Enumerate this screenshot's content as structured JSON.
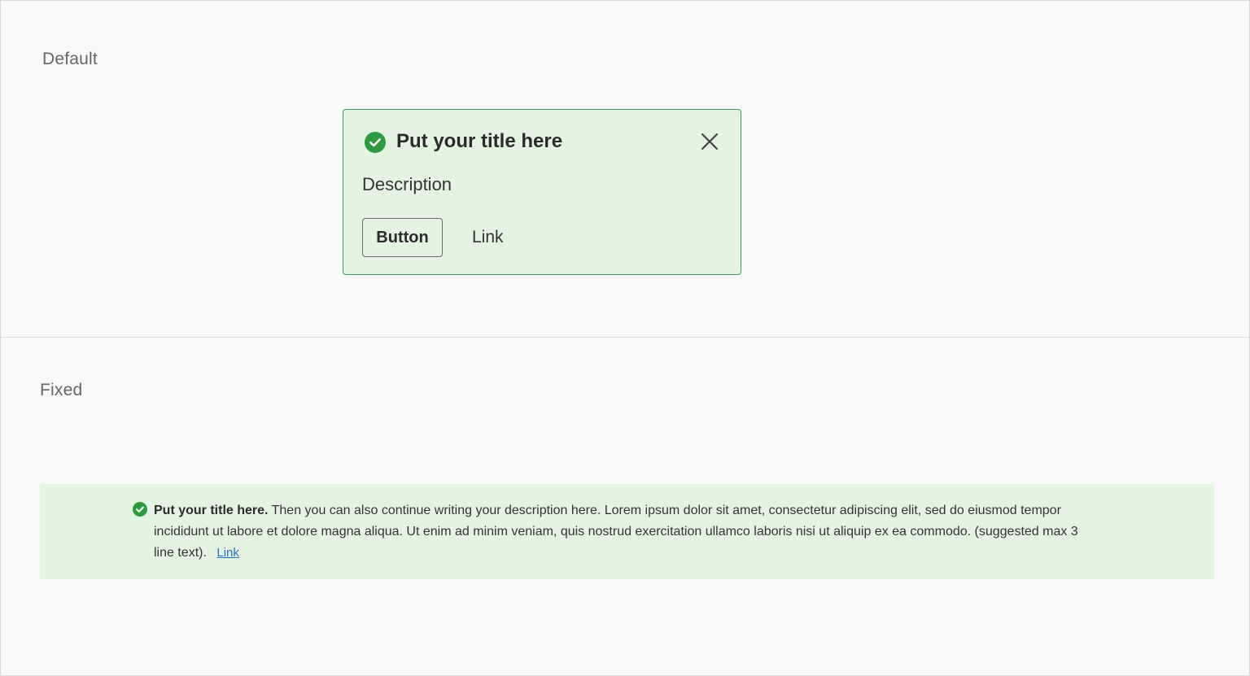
{
  "sections": {
    "default_label": "Default",
    "fixed_label": "Fixed"
  },
  "toast": {
    "title": "Put your title here",
    "description": "Description",
    "button_label": "Button",
    "link_label": "Link",
    "icon": "check-circle-icon",
    "close_icon": "close-icon"
  },
  "banner": {
    "title": "Put your title here.",
    "description": "Then you can also continue writing your description here.  Lorem ipsum dolor sit amet, consectetur adipiscing elit, sed do eiusmod tempor incididunt ut labore et dolore magna aliqua. Ut enim ad minim veniam, quis nostrud exercitation ullamco laboris nisi ut aliquip ex ea commodo. (suggested max 3 line text).",
    "link_label": "Link",
    "icon": "check-circle-icon"
  },
  "colors": {
    "success_bg": "#e3f5e1",
    "success_border": "#3e9a5a",
    "success_icon": "#2f9a43",
    "link_blue": "#2b6fc4",
    "page_bg": "#f8f8f8"
  }
}
